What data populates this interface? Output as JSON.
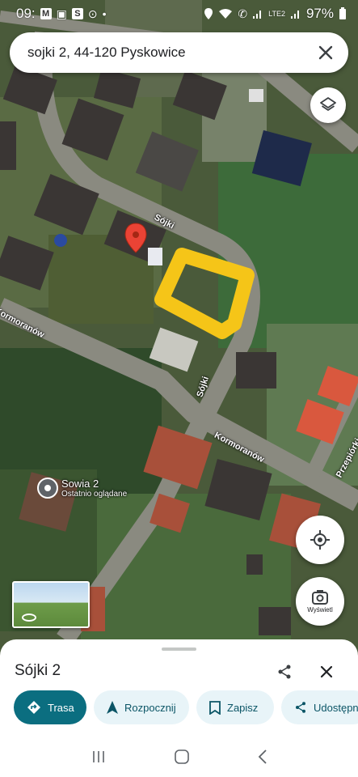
{
  "status_bar": {
    "time": "09:",
    "battery": "97%",
    "network": "LTE2"
  },
  "search": {
    "query": "sojki 2, 44-120 Pyskowice"
  },
  "map_labels": {
    "street_sojki_1": "Sójki",
    "street_sojki_2": "Sójki",
    "street_kormoranow_1": "Kormoranów",
    "street_kormoranow_2": "Kormoranów",
    "street_przepiorki": "Przepiórki"
  },
  "saved_place": {
    "name": "Sowia 2",
    "subtitle": "Ostatnio oglądane"
  },
  "streetview": {
    "label": "Wyświetl"
  },
  "sheet": {
    "title": "Sójki 2",
    "actions": {
      "route": "Trasa",
      "start": "Rozpocznij",
      "save": "Zapisz",
      "share": "Udostępnij"
    }
  },
  "colors": {
    "accent": "#0b6e80",
    "chip_bg": "#e8f4f8",
    "pin": "#ea4335",
    "highlight": "#f5c518"
  },
  "icons": [
    "wifi-icon",
    "signal-icon",
    "battery-icon",
    "close-icon",
    "layers-icon",
    "my-location-icon",
    "streetview-icon",
    "share-icon",
    "directions-icon",
    "navigation-icon",
    "bookmark-icon",
    "pin-icon"
  ]
}
